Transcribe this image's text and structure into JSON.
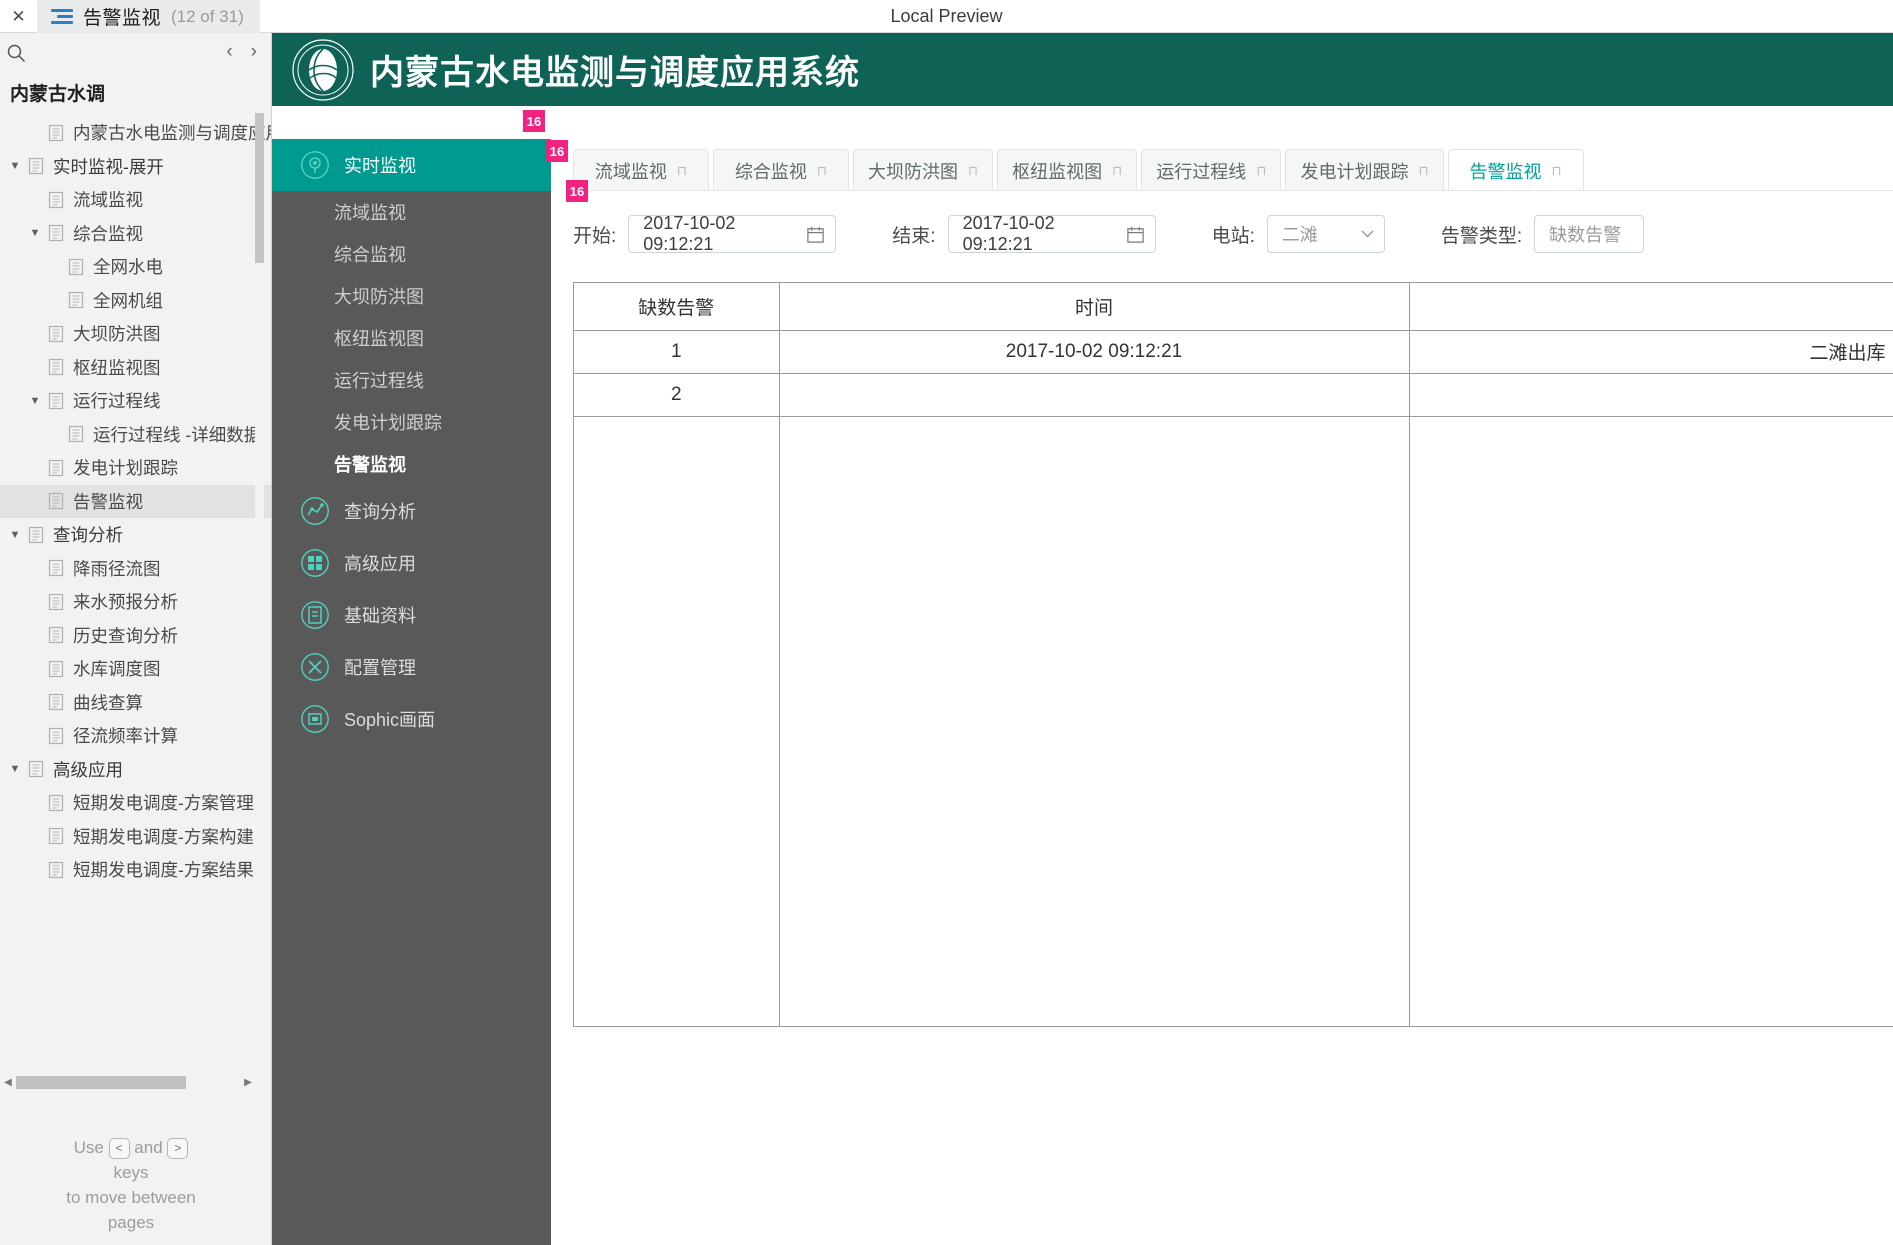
{
  "viewer": {
    "close_icon": "close-icon",
    "menu_icon": "hamburger-icon",
    "tab_title": "告警监视",
    "tab_count": "(12 of 31)",
    "preview_label": "Local Preview"
  },
  "outline": {
    "search_icon": "search-icon",
    "prev_icon": "‹",
    "next_icon": "›",
    "heading": "内蒙古水调",
    "items": [
      {
        "label": "内蒙古水电监测与调度应用",
        "depth": 1,
        "twisty": "",
        "selected": false
      },
      {
        "label": "实时监视-展开",
        "depth": 0,
        "twisty": "▼",
        "selected": false
      },
      {
        "label": "流域监视",
        "depth": 1,
        "twisty": "",
        "selected": false
      },
      {
        "label": "综合监视",
        "depth": 1,
        "twisty": "▼",
        "selected": false
      },
      {
        "label": "全网水电",
        "depth": 2,
        "twisty": "",
        "selected": false
      },
      {
        "label": "全网机组",
        "depth": 2,
        "twisty": "",
        "selected": false
      },
      {
        "label": "大坝防洪图",
        "depth": 1,
        "twisty": "",
        "selected": false
      },
      {
        "label": "枢纽监视图",
        "depth": 1,
        "twisty": "",
        "selected": false
      },
      {
        "label": "运行过程线",
        "depth": 1,
        "twisty": "▼",
        "selected": false
      },
      {
        "label": "运行过程线 -详细数据",
        "depth": 2,
        "twisty": "",
        "selected": false
      },
      {
        "label": "发电计划跟踪",
        "depth": 1,
        "twisty": "",
        "selected": false
      },
      {
        "label": "告警监视",
        "depth": 1,
        "twisty": "",
        "selected": true
      },
      {
        "label": "查询分析",
        "depth": 0,
        "twisty": "▼",
        "selected": false
      },
      {
        "label": "降雨径流图",
        "depth": 1,
        "twisty": "",
        "selected": false
      },
      {
        "label": "来水预报分析",
        "depth": 1,
        "twisty": "",
        "selected": false
      },
      {
        "label": "历史查询分析",
        "depth": 1,
        "twisty": "",
        "selected": false
      },
      {
        "label": "水库调度图",
        "depth": 1,
        "twisty": "",
        "selected": false
      },
      {
        "label": "曲线查算",
        "depth": 1,
        "twisty": "",
        "selected": false
      },
      {
        "label": "径流频率计算",
        "depth": 1,
        "twisty": "",
        "selected": false
      },
      {
        "label": "高级应用",
        "depth": 0,
        "twisty": "▼",
        "selected": false
      },
      {
        "label": "短期发电调度-方案管理",
        "depth": 1,
        "twisty": "",
        "selected": false
      },
      {
        "label": "短期发电调度-方案构建",
        "depth": 1,
        "twisty": "",
        "selected": false
      },
      {
        "label": "短期发电调度-方案结果",
        "depth": 1,
        "twisty": "",
        "selected": false
      }
    ],
    "hint": {
      "use": "Use",
      "key_prev": "<",
      "and": "and",
      "key_next": ">",
      "line2": "keys",
      "line3": "to move between",
      "line4": "pages"
    }
  },
  "app": {
    "logo_icon": "company-globe-logo",
    "title": "内蒙古水电监测与调度应用系统"
  },
  "sidenav": [
    {
      "label": "实时监视",
      "icon": "realtime-monitor-icon",
      "type": "group",
      "active": true
    },
    {
      "label": "流域监视",
      "type": "sub",
      "current": false
    },
    {
      "label": "综合监视",
      "type": "sub",
      "current": false
    },
    {
      "label": "大坝防洪图",
      "type": "sub",
      "current": false
    },
    {
      "label": "枢纽监视图",
      "type": "sub",
      "current": false
    },
    {
      "label": "运行过程线",
      "type": "sub",
      "current": false
    },
    {
      "label": "发电计划跟踪",
      "type": "sub",
      "current": false
    },
    {
      "label": "告警监视",
      "type": "sub",
      "current": true
    },
    {
      "label": "查询分析",
      "icon": "chart-analysis-icon",
      "type": "group",
      "active": false
    },
    {
      "label": "高级应用",
      "icon": "advanced-apps-icon",
      "type": "group",
      "active": false
    },
    {
      "label": "基础资料",
      "icon": "base-data-icon",
      "type": "group",
      "active": false
    },
    {
      "label": "配置管理",
      "icon": "config-tools-icon",
      "type": "group",
      "active": false
    },
    {
      "label": "Sophic画面",
      "icon": "sophic-screen-icon",
      "type": "group",
      "active": false
    }
  ],
  "tabs": [
    {
      "label": "流域监视",
      "close": "⊓",
      "active": false
    },
    {
      "label": "综合监视",
      "close": "⊓",
      "active": false
    },
    {
      "label": "大坝防洪图",
      "close": "⊓",
      "active": false
    },
    {
      "label": "枢纽监视图",
      "close": "⊓",
      "active": false
    },
    {
      "label": "运行过程线",
      "close": "⊓",
      "active": false
    },
    {
      "label": "发电计划跟踪",
      "close": "⊓",
      "active": false
    },
    {
      "label": "告警监视",
      "close": "⊓",
      "active": true
    }
  ],
  "filters": {
    "start_label": "开始:",
    "start_value": "2017-10-02 09:12:21",
    "end_label": "结束:",
    "end_value": "2017-10-02 09:12:21",
    "calendar_icon": "calendar-icon",
    "station_label": "电站:",
    "station_value": "二滩",
    "station_chevron": "chevron-down-icon",
    "alarm_type_label": "告警类型:",
    "alarm_type_value": "缺数告警"
  },
  "table": {
    "headers": [
      "缺数告警",
      "时间",
      ""
    ],
    "rows": [
      {
        "index": "1",
        "time": "2017-10-02 09:12:21",
        "detail": "二滩出库"
      },
      {
        "index": "2",
        "time": "",
        "detail": ""
      }
    ]
  },
  "badges": [
    "16",
    "16",
    "16"
  ]
}
